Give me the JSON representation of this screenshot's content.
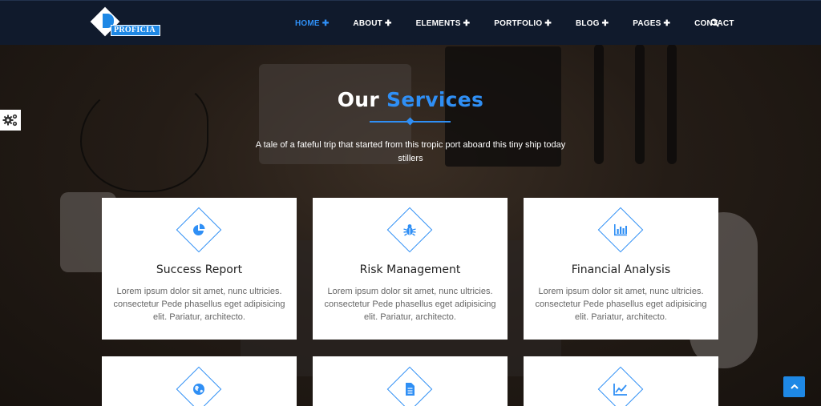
{
  "brand": {
    "name": "PROFICIA"
  },
  "nav": {
    "items": [
      {
        "label": "HOME",
        "suffix": "✚"
      },
      {
        "label": "ABOUT",
        "suffix": "✚"
      },
      {
        "label": "ELEMENTS",
        "suffix": "✚"
      },
      {
        "label": "PORTFOLIO",
        "suffix": "✚"
      },
      {
        "label": "BLOG",
        "suffix": "✚"
      },
      {
        "label": "PAGES",
        "suffix": "✚"
      },
      {
        "label": "CONTACT",
        "suffix": ""
      }
    ],
    "active_index": 0,
    "search_icon": "search-icon"
  },
  "section": {
    "title_part1": "Our",
    "title_part2": "Services",
    "subtitle": "A tale of a fateful trip that started from this tropic port aboard this tiny ship today stillers"
  },
  "cards": [
    {
      "title": "Success Report",
      "text": "Lorem ipsum dolor sit amet, nunc ultricies. consectetur Pede phasellus eget adipisicing elit. Pariatur, architecto.",
      "icon": "pie-chart-icon"
    },
    {
      "title": "Risk Management",
      "text": "Lorem ipsum dolor sit amet, nunc ultricies. consectetur Pede phasellus eget adipisicing elit. Pariatur, architecto.",
      "icon": "bug-icon"
    },
    {
      "title": "Financial Analysis",
      "text": "Lorem ipsum dolor sit amet, nunc ultricies. consectetur Pede phasellus eget adipisicing elit. Pariatur, architecto.",
      "icon": "bar-chart-icon"
    },
    {
      "title": "",
      "text": "",
      "icon": "globe-icon"
    },
    {
      "title": "",
      "text": "",
      "icon": "document-icon"
    },
    {
      "title": "",
      "text": "",
      "icon": "line-chart-icon"
    }
  ],
  "colors": {
    "accent": "#2f8ff5",
    "header_bg": "#101a2c",
    "back_to_top": "#1e88e5"
  }
}
